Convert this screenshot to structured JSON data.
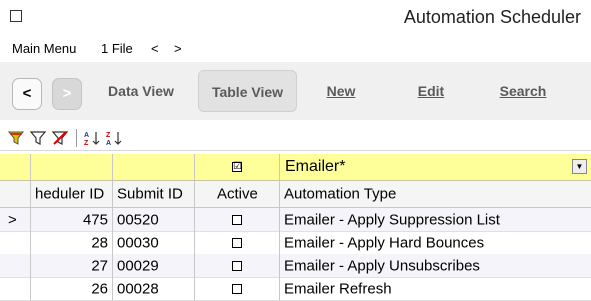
{
  "window": {
    "title": "Automation Scheduler"
  },
  "menu": {
    "main": "Main Menu",
    "file": "1 File",
    "back": "<",
    "forward": ">"
  },
  "toolbar": {
    "back_label": "<",
    "forward_label": ">",
    "data_view": "Data View",
    "table_view": "Table View",
    "new": "New",
    "edit": "Edit",
    "search": "Search"
  },
  "filter_row": {
    "active_checked": "☑",
    "automation_type_value": "Emailer*"
  },
  "table": {
    "columns": [
      "heduler ID",
      "Submit ID",
      "Active",
      "Automation Type"
    ],
    "rows": [
      {
        "marker": ">",
        "scheduler_id": "475",
        "submit_id": "00520",
        "active": false,
        "type": "Emailer - Apply Suppression List"
      },
      {
        "marker": "",
        "scheduler_id": "28",
        "submit_id": "00030",
        "active": false,
        "type": "Emailer - Apply Hard Bounces"
      },
      {
        "marker": "",
        "scheduler_id": "27",
        "submit_id": "00029",
        "active": false,
        "type": "Emailer - Apply Unsubscribes"
      },
      {
        "marker": "",
        "scheduler_id": "26",
        "submit_id": "00028",
        "active": false,
        "type": "Emailer Refresh"
      }
    ]
  }
}
